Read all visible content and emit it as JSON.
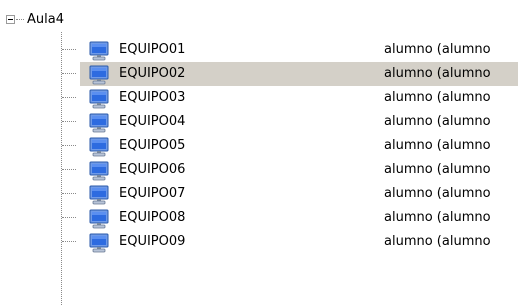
{
  "tree": {
    "root": {
      "label": "Aula4",
      "icon": "collapse-minus-icon"
    },
    "item_icon": "computer-monitor-icon",
    "selected_index": 1,
    "items": [
      {
        "name": "EQUIPO01",
        "user": "alumno (alumno"
      },
      {
        "name": "EQUIPO02",
        "user": "alumno (alumno"
      },
      {
        "name": "EQUIPO03",
        "user": "alumno (alumno"
      },
      {
        "name": "EQUIPO04",
        "user": "alumno (alumno"
      },
      {
        "name": "EQUIPO05",
        "user": "alumno (alumno"
      },
      {
        "name": "EQUIPO06",
        "user": "alumno (alumno"
      },
      {
        "name": "EQUIPO07",
        "user": "alumno (alumno"
      },
      {
        "name": "EQUIPO08",
        "user": "alumno (alumno"
      },
      {
        "name": "EQUIPO09",
        "user": "alumno (alumno"
      }
    ]
  },
  "colors": {
    "selection": "#d4d0c8",
    "monitor_frame": "#6f9ae8",
    "monitor_screen": "#2d6be0",
    "connector": "#8a8a8a"
  }
}
